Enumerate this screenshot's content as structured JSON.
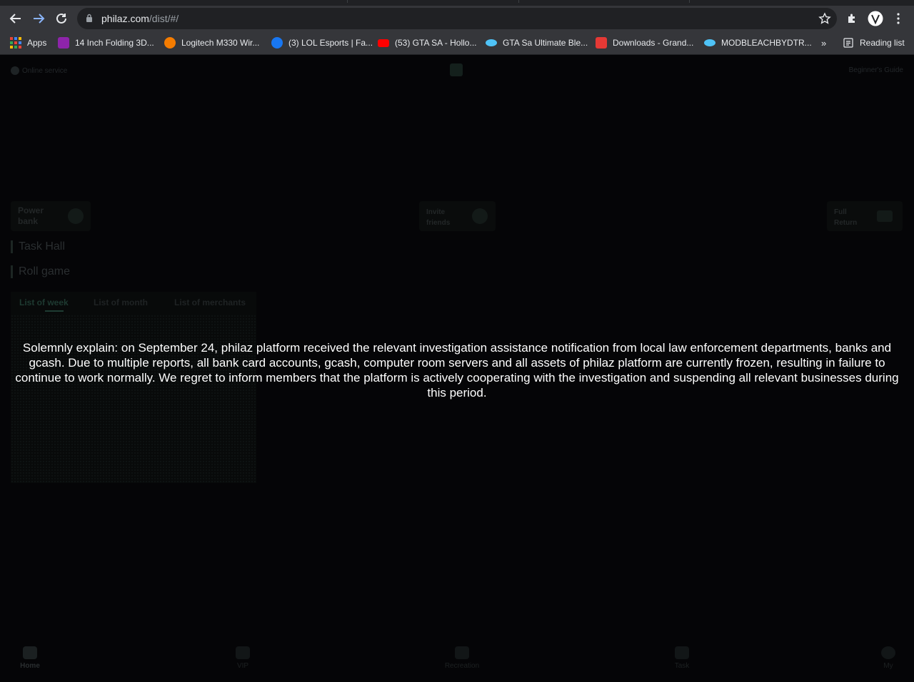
{
  "browser": {
    "url_host": "philaz.com",
    "url_path": "/dist/#/",
    "bookmarks": [
      {
        "label": "Apps",
        "color": "#4285f4"
      },
      {
        "label": "14 Inch Folding 3D...",
        "color": "#8e24aa"
      },
      {
        "label": "Logitech M330 Wir...",
        "color": "#f57c00"
      },
      {
        "label": "(3) LOL Esports | Fa...",
        "color": "#1877f2"
      },
      {
        "label": "(53) GTA SA - Hollo...",
        "color": "#ff0000"
      },
      {
        "label": "GTA Sa Ultimate Ble...",
        "color": "#4fc3f7"
      },
      {
        "label": "Downloads - Grand...",
        "color": "#e53935"
      },
      {
        "label": "MODBLEACHBYDTR...",
        "color": "#4fc3f7"
      }
    ],
    "more_bookmarks": "»",
    "reading_list": "Reading list"
  },
  "header": {
    "online_service": "Online service",
    "beginners_guide": "Beginner's Guide"
  },
  "cards": [
    {
      "line1": "Power",
      "line2": "bank"
    },
    {
      "line1": "Invite",
      "line2": "friends"
    },
    {
      "line1": "Full",
      "line2": "Return"
    }
  ],
  "sections": {
    "task_hall": "Task Hall",
    "roll_game": "Roll game"
  },
  "list_tabs": [
    {
      "label": "List of week",
      "active": true
    },
    {
      "label": "List of month",
      "active": false
    },
    {
      "label": "List of merchants",
      "active": false
    }
  ],
  "notice": "Solemnly explain: on September 24, philaz platform received the relevant investigation assistance notification from local law enforcement departments, banks and gcash. Due to multiple reports, all bank card accounts, gcash, computer room servers and all assets of philaz platform are currently frozen, resulting in failure to continue to work normally. We regret to inform members that the platform is actively cooperating with the investigation and suspending all relevant businesses during this period.",
  "bottom_nav": [
    {
      "label": "Home",
      "icon": "home-icon",
      "active": true
    },
    {
      "label": "VIP",
      "icon": "diamond-icon",
      "active": false
    },
    {
      "label": "Recreation",
      "icon": "gift-icon",
      "active": false
    },
    {
      "label": "Task",
      "icon": "task-icon",
      "active": false
    },
    {
      "label": "My",
      "icon": "user-icon",
      "active": false
    }
  ]
}
